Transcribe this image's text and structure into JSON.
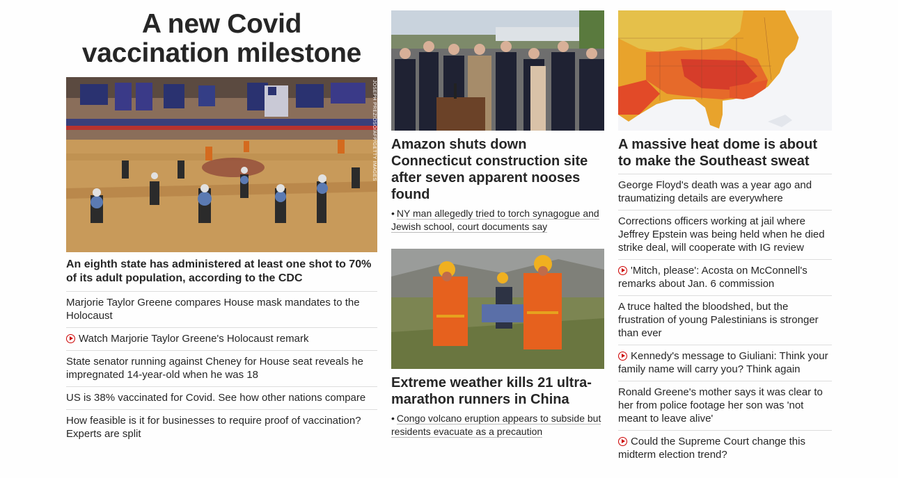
{
  "col1": {
    "headline": "A new Covid vaccination milestone",
    "image": {
      "alt": "vaccination site in gym",
      "credit": "JOSEPH PREZIOSO/AFP/GETTY IMAGES"
    },
    "caption": "An eighth state has administered at least one shot to 70% of its adult population, according to the CDC",
    "items": [
      {
        "text": "Marjorie Taylor Greene compares House mask mandates to the Holocaust",
        "video": false
      },
      {
        "text": "Watch Marjorie Taylor Greene's Holocaust remark",
        "video": true
      },
      {
        "text": "State senator running against Cheney for House seat reveals he impregnated 14-year-old when he was 18",
        "video": false
      },
      {
        "text": "US is 38% vaccinated for Covid. See how other nations compare",
        "video": false
      },
      {
        "text": "How feasible is it for businesses to require proof of vaccination? Experts are split",
        "video": false
      }
    ]
  },
  "col2": {
    "story1": {
      "headline": "Amazon shuts down Connecticut construction site after seven apparent nooses found",
      "related": "NY man allegedly tried to torch synagogue and Jewish school, court documents say"
    },
    "story2": {
      "headline": "Extreme weather kills 21 ultra-marathon runners in China",
      "related": "Congo volcano eruption appears to subside but residents evacuate as a precaution"
    }
  },
  "col3": {
    "headline": "A massive heat dome is about to make the Southeast sweat",
    "items": [
      {
        "text": "George Floyd's death was a year ago and traumatizing details are everywhere",
        "video": false
      },
      {
        "text": "Corrections officers working at jail where Jeffrey Epstein was being held when he died strike deal, will cooperate with IG review",
        "video": false
      },
      {
        "text": "'Mitch, please': Acosta on McConnell's remarks about Jan. 6 commission",
        "video": true
      },
      {
        "text": "A truce halted the bloodshed, but the frustration of young Palestinians is stronger than ever",
        "video": false
      },
      {
        "text": "Kennedy's message to Giuliani: Think your family name will carry you? Think again",
        "video": true
      },
      {
        "text": "Ronald Greene's mother says it was clear to her from police footage her son was 'not meant to leave alive'",
        "video": false
      },
      {
        "text": "Could the Supreme Court change this midterm election trend?",
        "video": true
      }
    ]
  },
  "colors": {
    "video_icon": "#cc0000",
    "text": "#262626",
    "divider": "#dddddd"
  }
}
